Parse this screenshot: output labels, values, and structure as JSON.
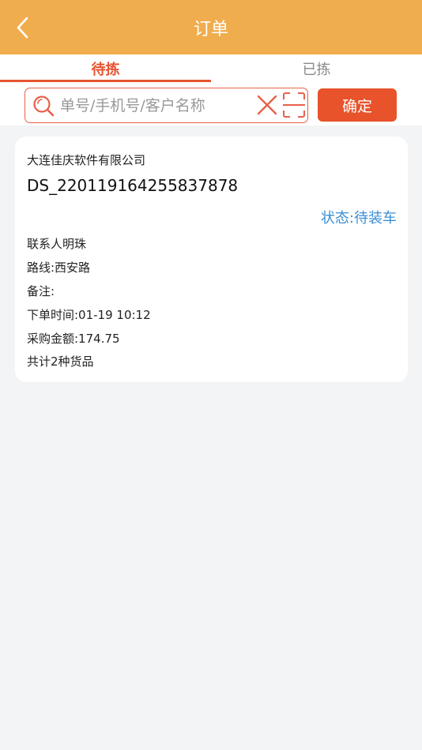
{
  "header": {
    "title": "订单"
  },
  "tabs": [
    {
      "label": "待拣"
    },
    {
      "label": "已拣"
    }
  ],
  "search": {
    "placeholder": "单号/手机号/客户名称",
    "value": ""
  },
  "actions": {
    "confirm_label": "确定"
  },
  "order": {
    "company": "大连佳庆软件有限公司",
    "order_no": "DS_220119164255837878",
    "status": "状态:待装车",
    "contact": "联系人明珠",
    "route": "路线:西安路",
    "note": "备注:",
    "order_time": "下单时间:01-19 10:12",
    "amount": "采购金额:174.75",
    "items_count": "共计2种货品"
  },
  "colors": {
    "header": "#f0ad4e",
    "accent": "#e55431",
    "status": "#3b8fd6",
    "background": "#f3f4f6"
  }
}
